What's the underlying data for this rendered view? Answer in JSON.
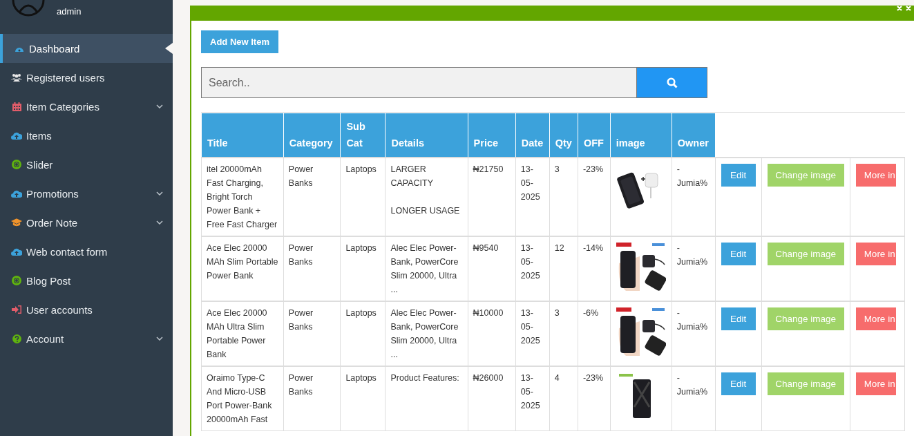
{
  "sidebar": {
    "user": "admin",
    "items": [
      {
        "label": "Dashboard",
        "kind": "gauge",
        "selected": true,
        "has_submenu": false
      },
      {
        "label": "Registered users",
        "kind": "users",
        "selected": false,
        "has_submenu": false
      },
      {
        "label": "Item Categories",
        "kind": "calendar",
        "selected": false,
        "has_submenu": true
      },
      {
        "label": "Items",
        "kind": "cloud",
        "selected": false,
        "has_submenu": false
      },
      {
        "label": "Slider",
        "kind": "lifebuoy",
        "selected": false,
        "has_submenu": false
      },
      {
        "label": "Promotions",
        "kind": "cloud",
        "selected": false,
        "has_submenu": true
      },
      {
        "label": "Order Note",
        "kind": "cap",
        "selected": false,
        "has_submenu": true
      },
      {
        "label": "Web contact form",
        "kind": "cloud",
        "selected": false,
        "has_submenu": false
      },
      {
        "label": "Blog Post",
        "kind": "lifebuoy",
        "selected": false,
        "has_submenu": false
      },
      {
        "label": "User accounts",
        "kind": "signin",
        "selected": false,
        "has_submenu": false
      },
      {
        "label": "Account",
        "kind": "question",
        "selected": false,
        "has_submenu": true
      }
    ]
  },
  "panel": {
    "add_button": "Add New Item",
    "search": {
      "placeholder": "Search.."
    },
    "table": {
      "columns": [
        "Title",
        "Category",
        "Sub Cat",
        "Details",
        "Price",
        "Date",
        "Qty",
        "OFF",
        "image",
        "Owner"
      ],
      "rows": [
        {
          "title": "itel 20000mAh Fast Charging, Bright Torch Power Bank + Free Fast Charger",
          "category": "Power Banks",
          "sub_cat": "Laptops",
          "details": "LARGER CAPACITY\n\nLONGER USAGE",
          "price": "₦21750",
          "date": "13-05-2025",
          "qty": "3",
          "off": "-23%",
          "image": {
            "kind": "picture"
          },
          "owner": "- Jumia%",
          "actions": [
            "Edit",
            "Change image",
            "More in"
          ]
        },
        {
          "title": "Ace Elec 20000 MAh Slim Portable Power Bank",
          "category": "Power Banks",
          "sub_cat": "Laptops",
          "details": "Alec Elec Power-Bank, PowerCore Slim 20000, Ultra ...",
          "price": "₦9540",
          "date": "13-05-2025",
          "qty": "12",
          "off": "-14%",
          "image": {
            "kind": "picture"
          },
          "owner": "- Jumia%",
          "actions": [
            "Edit",
            "Change image",
            "More in"
          ]
        },
        {
          "title": "Ace Elec 20000 MAh Ultra Slim Portable Power Bank",
          "category": "Power Banks",
          "sub_cat": "Laptops",
          "details": "Alec Elec Power-Bank, PowerCore Slim 20000, Ultra ...",
          "price": "₦10000",
          "date": "13-05-2025",
          "qty": "3",
          "off": "-6%",
          "image": {
            "kind": "picture"
          },
          "owner": "- Jumia%",
          "actions": [
            "Edit",
            "Change image",
            "More in"
          ]
        },
        {
          "title": "Oraimo Type-C And Micro-USB Port Power-Bank 20000mAh Fast",
          "category": "Power Banks",
          "sub_cat": "Laptops",
          "details": "Product Features:",
          "price": "₦26000",
          "date": "13-05-2025",
          "qty": "4",
          "off": "-23%",
          "image": {
            "kind": "picture"
          },
          "owner": "- Jumia%",
          "actions": [
            "Edit",
            "Change image",
            "More in"
          ]
        }
      ]
    }
  }
}
